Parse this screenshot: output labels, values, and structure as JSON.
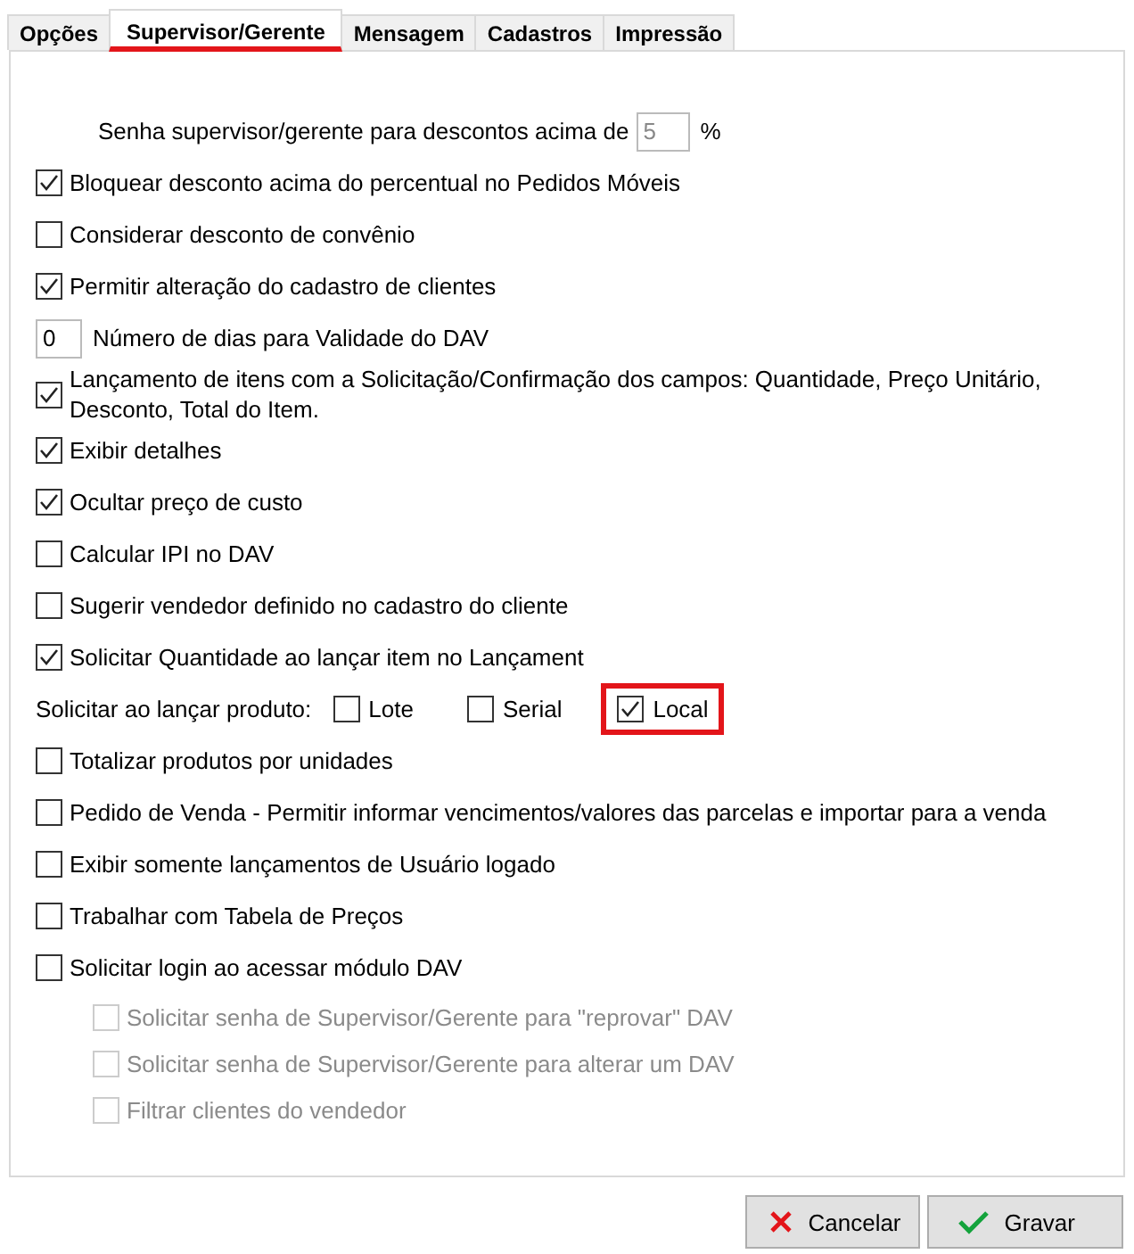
{
  "tabs": [
    {
      "label": "Opções",
      "selected": false,
      "highlighted": false
    },
    {
      "label": "Supervisor/Gerente",
      "selected": true,
      "highlighted": true
    },
    {
      "label": "Mensagem",
      "selected": false,
      "highlighted": false
    },
    {
      "label": "Cadastros",
      "selected": false,
      "highlighted": false
    },
    {
      "label": "Impressão",
      "selected": false,
      "highlighted": false
    }
  ],
  "rows": [
    {
      "kind": "percent",
      "label": "Senha supervisor/gerente para descontos acima de",
      "value": "5",
      "suffix": "%"
    },
    {
      "kind": "check",
      "label": "Bloquear desconto acima do percentual no Pedidos Móveis",
      "checked": true
    },
    {
      "kind": "check",
      "label": "Considerar desconto de convênio",
      "checked": false
    },
    {
      "kind": "check",
      "label": "Permitir alteração do cadastro de clientes",
      "checked": true
    },
    {
      "kind": "days",
      "value": "0",
      "label": "Número de dias para Validade do DAV"
    },
    {
      "kind": "check",
      "label": "Lançamento de itens com a Solicitação/Confirmação  dos campos: Quantidade, Preço Unitário, Desconto, Total do Item.",
      "checked": true
    },
    {
      "kind": "check",
      "label": "Exibir detalhes",
      "checked": true
    },
    {
      "kind": "check",
      "label": "Ocultar preço de custo",
      "checked": true
    },
    {
      "kind": "check",
      "label": "Calcular IPI no DAV",
      "checked": false
    },
    {
      "kind": "check",
      "label": "Sugerir vendedor definido no cadastro do cliente",
      "checked": false
    },
    {
      "kind": "check",
      "label": "Solicitar Quantidade ao lançar item no Lançament",
      "checked": true
    },
    {
      "kind": "group",
      "label": "Solicitar ao lançar produto:",
      "options": [
        {
          "label": "Lote",
          "checked": false,
          "highlighted": false
        },
        {
          "label": "Serial",
          "checked": false,
          "highlighted": false
        },
        {
          "label": "Local",
          "checked": true,
          "highlighted": true
        }
      ]
    },
    {
      "kind": "check",
      "label": "Totalizar produtos por unidades",
      "checked": false
    },
    {
      "kind": "check",
      "label": "Pedido de Venda - Permitir informar vencimentos/valores das parcelas e importar para a venda",
      "checked": false
    },
    {
      "kind": "check",
      "label": "Exibir somente lançamentos de Usuário logado",
      "checked": false
    },
    {
      "kind": "check",
      "label": "Trabalhar com Tabela de Preços",
      "checked": false
    },
    {
      "kind": "check",
      "label": "Solicitar login ao acessar módulo DAV",
      "checked": false,
      "children": [
        {
          "label": "Solicitar senha de Supervisor/Gerente para \"reprovar\" DAV",
          "checked": false,
          "disabled": true
        },
        {
          "label": "Solicitar senha de Supervisor/Gerente para alterar um DAV",
          "checked": false,
          "disabled": true
        },
        {
          "label": "Filtrar clientes do vendedor",
          "checked": false,
          "disabled": true
        }
      ]
    }
  ],
  "buttons": [
    {
      "kind": "cancel",
      "label": "Cancelar"
    },
    {
      "kind": "save",
      "label": "Gravar"
    }
  ]
}
